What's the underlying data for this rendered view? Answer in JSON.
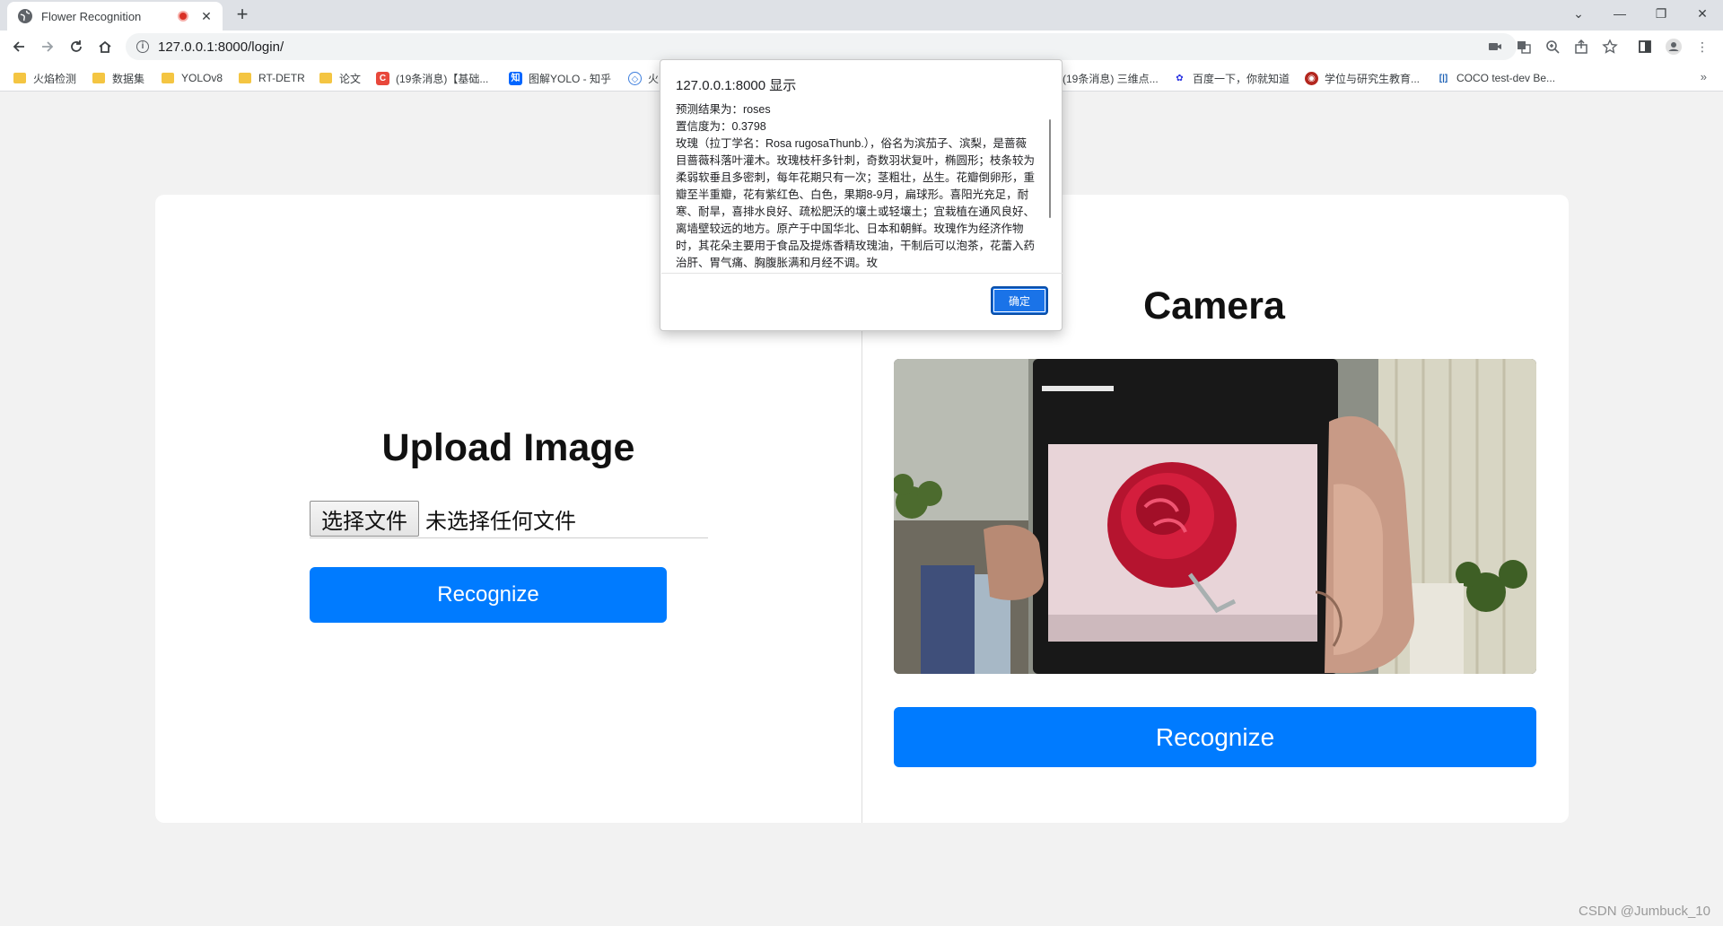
{
  "browser": {
    "tab_title": "Flower Recognition",
    "url": "127.0.0.1:8000/login/",
    "bookmarks": [
      {
        "label": "火焰检测",
        "icon": "folder-icon"
      },
      {
        "label": "数据集",
        "icon": "folder-icon"
      },
      {
        "label": "YOLOv8",
        "icon": "folder-icon"
      },
      {
        "label": "RT-DETR",
        "icon": "folder-icon"
      },
      {
        "label": "论文",
        "icon": "folder-icon"
      },
      {
        "label": "(19条消息)【基础...",
        "icon": "csdn-icon"
      },
      {
        "label": "图解YOLO - 知乎",
        "icon": "zhihu-icon"
      },
      {
        "label": "火",
        "icon": "site-icon"
      },
      {
        "label": "(19条消息) 三维点...",
        "icon": "csdn-icon"
      },
      {
        "label": "百度一下，你就知道",
        "icon": "baidu-icon"
      },
      {
        "label": "学位与研究生教育...",
        "icon": "edu-icon"
      },
      {
        "label": "COCO test-dev Be...",
        "icon": "paperswithcode-icon"
      }
    ],
    "bookmark_more": "»",
    "new_tab": "+",
    "tab_close": "✕"
  },
  "page": {
    "upload_title": "Upload Image",
    "file_button": "选择文件",
    "file_status": "未选择任何文件",
    "recognize_left": "Recognize",
    "camera_title": "Camera",
    "recognize_right": "Recognize",
    "watermark": "CSDN @Jumbuck_10"
  },
  "dialog": {
    "title": "127.0.0.1:8000 显示",
    "lines": [
      "预测结果为：roses",
      "置信度为：0.3798",
      "玫瑰（拉丁学名：Rosa rugosaThunb.），俗名为滨茄子、滨梨，是蔷薇目蔷薇科落叶灌木。玫瑰枝杆多针刺，奇数羽状复叶，椭圆形；枝条较为柔弱软垂且多密刺，每年花期只有一次；茎粗壮，丛生。花瓣倒卵形，重瓣至半重瓣，花有紫红色、白色，果期8-9月，扁球形。喜阳光充足，耐寒、耐旱，喜排水良好、疏松肥沃的壤土或轻壤土；宜栽植在通风良好、离墙壁较远的地方。原产于中国华北、日本和朝鲜。玫瑰作为经济作物时，其花朵主要用于食品及提炼香精玫瑰油，干制后可以泡茶，花蕾入药治肝、胃气痛、胸腹胀满和月经不调。玫"
    ],
    "ok_button": "确定"
  },
  "colors": {
    "accent": "#007bff",
    "dialog_button": "#1a73e8",
    "folder": "#f4c542",
    "csdn": "#e8483b",
    "zhihu": "#0066ff"
  }
}
